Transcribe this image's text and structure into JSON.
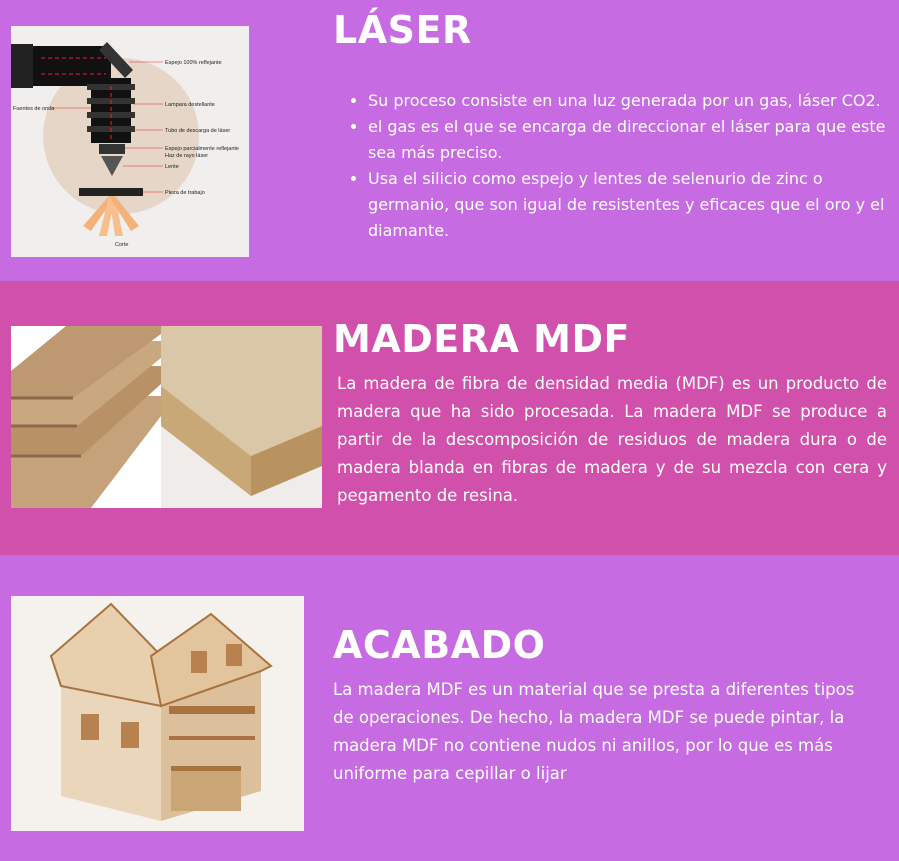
{
  "laser": {
    "title": "LÁSER",
    "bullets": [
      "Su proceso consiste en una luz generada por un gas, láser CO2.",
      "el gas es el que se encarga de direccionar el láser para que este sea más preciso.",
      "Usa el silicio como espejo y lentes de selenurio de zinc o germanio, que son igual de resistentes y eficaces que el oro y el diamante."
    ],
    "diagram_labels": {
      "mirror_full": "Espejo 100% reflejante",
      "wave_source": "Fuentes de onda",
      "flash_lamp": "Lampara destellante",
      "discharge_tube": "Tubo de descarga de láser",
      "partial_mirror": "Espejo parcialmente reflejante",
      "beam": "Haz de rayo láser",
      "lens": "Lente",
      "workpiece": "Pieza de trabajo",
      "cut": "Corte"
    }
  },
  "mdf": {
    "title": "MADERA MDF",
    "text": "La madera de fibra de densidad media (MDF) es un producto de madera que ha sido procesada. La madera MDF se produce a partir de la descomposición de residuos de madera dura o de madera blanda en fibras de madera y de su mezcla con cera y pegamento de resina."
  },
  "acabado": {
    "title": "ACABADO",
    "text": "La madera MDF es un material que se presta a diferentes tipos de operaciones. De hecho, la madera MDF se puede pintar, la madera MDF no contiene nudos ni anillos, por lo que es más uniforme para cepillar o lijar"
  },
  "colors": {
    "violet": "#c66be2",
    "magenta": "#d150ab"
  }
}
